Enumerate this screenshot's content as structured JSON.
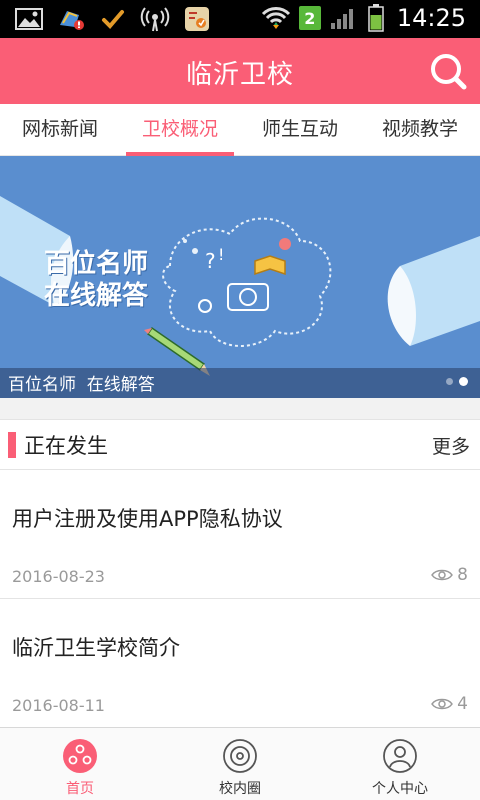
{
  "status_bar": {
    "time": "14:25",
    "sim_slot": "2",
    "icons": [
      "gallery-icon",
      "app-update-icon",
      "checkmark-icon",
      "wifi-hotspot-icon",
      "app-icon",
      "wifi-icon",
      "signal-icon",
      "battery-icon"
    ]
  },
  "header": {
    "title": "临沂卫校",
    "search_icon": "search-icon"
  },
  "tabs": [
    {
      "label": "网标新闻",
      "active": false
    },
    {
      "label": "卫校概况",
      "active": true
    },
    {
      "label": "师生互动",
      "active": false
    },
    {
      "label": "视频教学",
      "active": false
    }
  ],
  "banner": {
    "headline_line1": "百位名师",
    "headline_line2": "在线解答",
    "caption": "百位名师  在线解答",
    "slide_count": 2,
    "active_slide": 2
  },
  "section": {
    "title": "正在发生",
    "more_label": "更多"
  },
  "news": [
    {
      "title": "用户注册及使用APP隐私协议",
      "date": "2016-08-23",
      "views": "8"
    },
    {
      "title": "临沂卫生学校简介",
      "date": "2016-08-11",
      "views": "4"
    }
  ],
  "bottom_nav": [
    {
      "label": "首页",
      "icon": "home-icon",
      "active": true
    },
    {
      "label": "校内圈",
      "icon": "campus-circle-icon",
      "active": false
    },
    {
      "label": "个人中心",
      "icon": "profile-icon",
      "active": false
    }
  ],
  "colors": {
    "accent": "#fa5e76",
    "banner_bg": "#5a8ecf",
    "status_bar": "#000000",
    "muted_text": "#9a9a9a"
  }
}
